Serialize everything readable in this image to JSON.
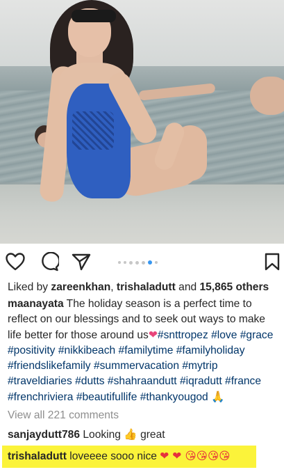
{
  "post": {
    "carousel": {
      "total_dots": 7,
      "active_index": 5
    },
    "likes": {
      "prefix": "Liked by ",
      "user1": "zareenkhan",
      "sep": ", ",
      "user2": "trishaladutt",
      "and": " and ",
      "count": "15,865 others"
    },
    "caption": {
      "username": "maanayata",
      "text": " The holiday season is a perfect time to reflect on our blessings and to seek out ways to make life better for those around us",
      "heart": "❤",
      "hashtags": [
        "#snttropez",
        "#love",
        "#grace",
        "#positivity",
        "#nikkibeach",
        "#familytime",
        "#familyholiday",
        "#friendslikefamily",
        "#summervacation",
        "#mytrip",
        "#traveldiaries",
        "#dutts",
        "#shahraandutt",
        "#iqradutt",
        "#france",
        "#frenchriviera",
        "#beautifullife",
        "#thankyougod"
      ],
      "end_emoji": "🙏"
    },
    "view_all": "View all 221 comments",
    "comments": [
      {
        "username": "sanjaydutt786",
        "text_before": " Looking ",
        "emoji": "👍",
        "text_after": " great"
      },
      {
        "username": "trishaladutt",
        "text": " loveeee sooo nice ",
        "emojis": "❤ ❤ 😘😘😘😘"
      }
    ]
  },
  "icons": [
    "heart-outline-icon",
    "comment-bubble-icon",
    "share-paper-plane-icon",
    "bookmark-icon"
  ],
  "colors": {
    "hashtag": "#003569",
    "active_dot": "#3897f0",
    "highlight": "#fbf33a",
    "muted": "#8e8e8e"
  }
}
